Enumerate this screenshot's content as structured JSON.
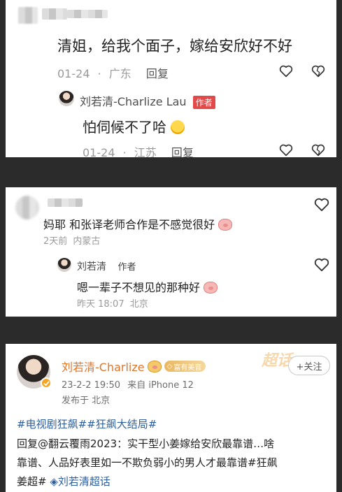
{
  "comment1": {
    "text": "清姐，给我个面子，嫁给安欣好不好",
    "date": "01-24",
    "sep": "·",
    "location": "广东",
    "reply_label": "回复",
    "reply": {
      "author_name": "刘若清-Charlize Lau",
      "author_tag": "作者",
      "text": "怕伺候不了哈",
      "date": "01-24",
      "sep": "·",
      "location": "江苏",
      "reply_label": "回复"
    }
  },
  "comment2": {
    "text": "妈耶 和张译老师合作是不感觉很好",
    "time": "2天前",
    "location": "内蒙古",
    "reply": {
      "author_name": "刘若清",
      "author_tag": "作者",
      "text": "嗯一辈子不想见的那种好",
      "time": "昨天 18:07",
      "location": "北京"
    }
  },
  "post": {
    "author_name": "刘若清-Charlize",
    "badge_label": "富有美音",
    "super_label": "超话",
    "follow_label": "+关注",
    "datetime": "23-2-2 19:50",
    "source": "来自 iPhone 12",
    "published_at": "发布于 北京",
    "tags_line": "#电视剧狂飙##狂飙大结局#",
    "body_line1": "回复@翻云覆雨2023：实干型小姜嫁给安欣最靠谱…啥",
    "body_line2": "靠谱、人品好表里如一不欺负弱小的男人才最靠谱#狂飙",
    "body_line3": "姜超#",
    "body_line3_tail": "刘若清超话"
  },
  "colors": {
    "background": "#2b2b2b",
    "author_tag": "#e24a4a",
    "hashtag": "#2f5f9a",
    "meta_text": "#9a9a9a"
  },
  "icons": [
    "heart-icon",
    "broken-heart-icon",
    "diamond-icon",
    "verified-icon",
    "pig-emoji",
    "laughing-emoji"
  ]
}
